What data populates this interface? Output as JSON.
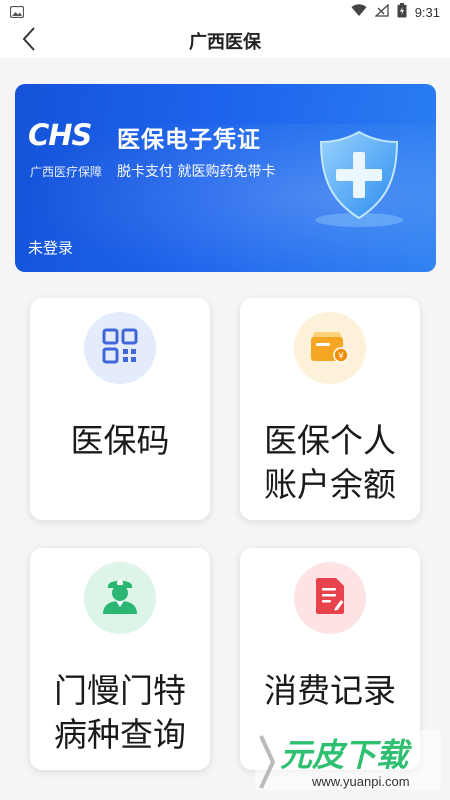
{
  "status_bar": {
    "time": "9:31"
  },
  "header": {
    "title": "广西医保"
  },
  "banner": {
    "logo": "CHS",
    "title": "医保电子凭证",
    "org": "广西医疗保障",
    "slogan": "脱卡支付 就医购药免带卡",
    "login_status": "未登录"
  },
  "cards": [
    {
      "label_line1": "医保码",
      "label_line2": "",
      "icon": "qr-code-icon",
      "color": "#3f67d8"
    },
    {
      "label_line1": "医保个人",
      "label_line2": "账户余额",
      "icon": "wallet-icon",
      "color": "#f5a623"
    },
    {
      "label_line1": "门慢门特",
      "label_line2": "病种查询",
      "icon": "doctor-icon",
      "color": "#2bb673"
    },
    {
      "label_line1": "消费记录",
      "label_line2": "",
      "icon": "document-icon",
      "color": "#e8424d"
    }
  ],
  "watermark": {
    "text": "元皮下载",
    "url": "www.yuanpi.com"
  }
}
